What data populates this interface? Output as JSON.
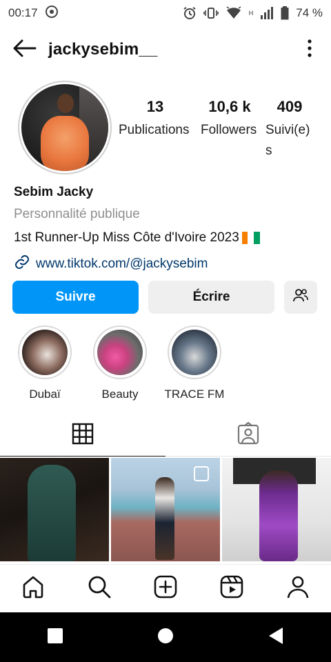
{
  "status_bar": {
    "time": "00:17",
    "network_label": "H",
    "battery_percent": "74 %",
    "icons": [
      "notification-dot-icon",
      "alarm-icon",
      "vibrate-icon",
      "wifi-icon",
      "signal-icon",
      "battery-icon"
    ]
  },
  "header": {
    "username": "jackysebim__",
    "icons": [
      "back-arrow-icon",
      "more-vertical-icon"
    ]
  },
  "stats": {
    "posts_count": "13",
    "posts_label": "Publications",
    "followers_count": "10,6 k",
    "followers_label": "Followers",
    "following_count": "409",
    "following_label": "Suivi(e)s"
  },
  "bio": {
    "name": "Sebim Jacky",
    "category": "Personnalité publique",
    "tagline": "1st Runner-Up Miss Côte d'Ivoire 2023",
    "link": "www.tiktok.com/@jackysebim",
    "flag_colors": [
      "#f77f00",
      "#ffffff",
      "#009e60"
    ]
  },
  "actions": {
    "follow_label": "Suivre",
    "message_label": "Écrire",
    "follow_color": "#0095f6",
    "icons": [
      "suggested-people-icon"
    ]
  },
  "highlights": [
    {
      "label": "Dubaï"
    },
    {
      "label": "Beauty"
    },
    {
      "label": "TRACE FM"
    }
  ],
  "tabs": [
    {
      "name": "posts-grid",
      "icon": "grid-icon",
      "selected": true
    },
    {
      "name": "tagged",
      "icon": "tagged-person-icon",
      "selected": false
    }
  ],
  "bottom_nav": {
    "icons": [
      "home-icon",
      "search-icon",
      "create-post-icon",
      "reels-icon",
      "profile-icon"
    ]
  },
  "android_nav": {
    "icons": [
      "recents-square-icon",
      "home-circle-icon",
      "back-triangle-icon"
    ]
  }
}
